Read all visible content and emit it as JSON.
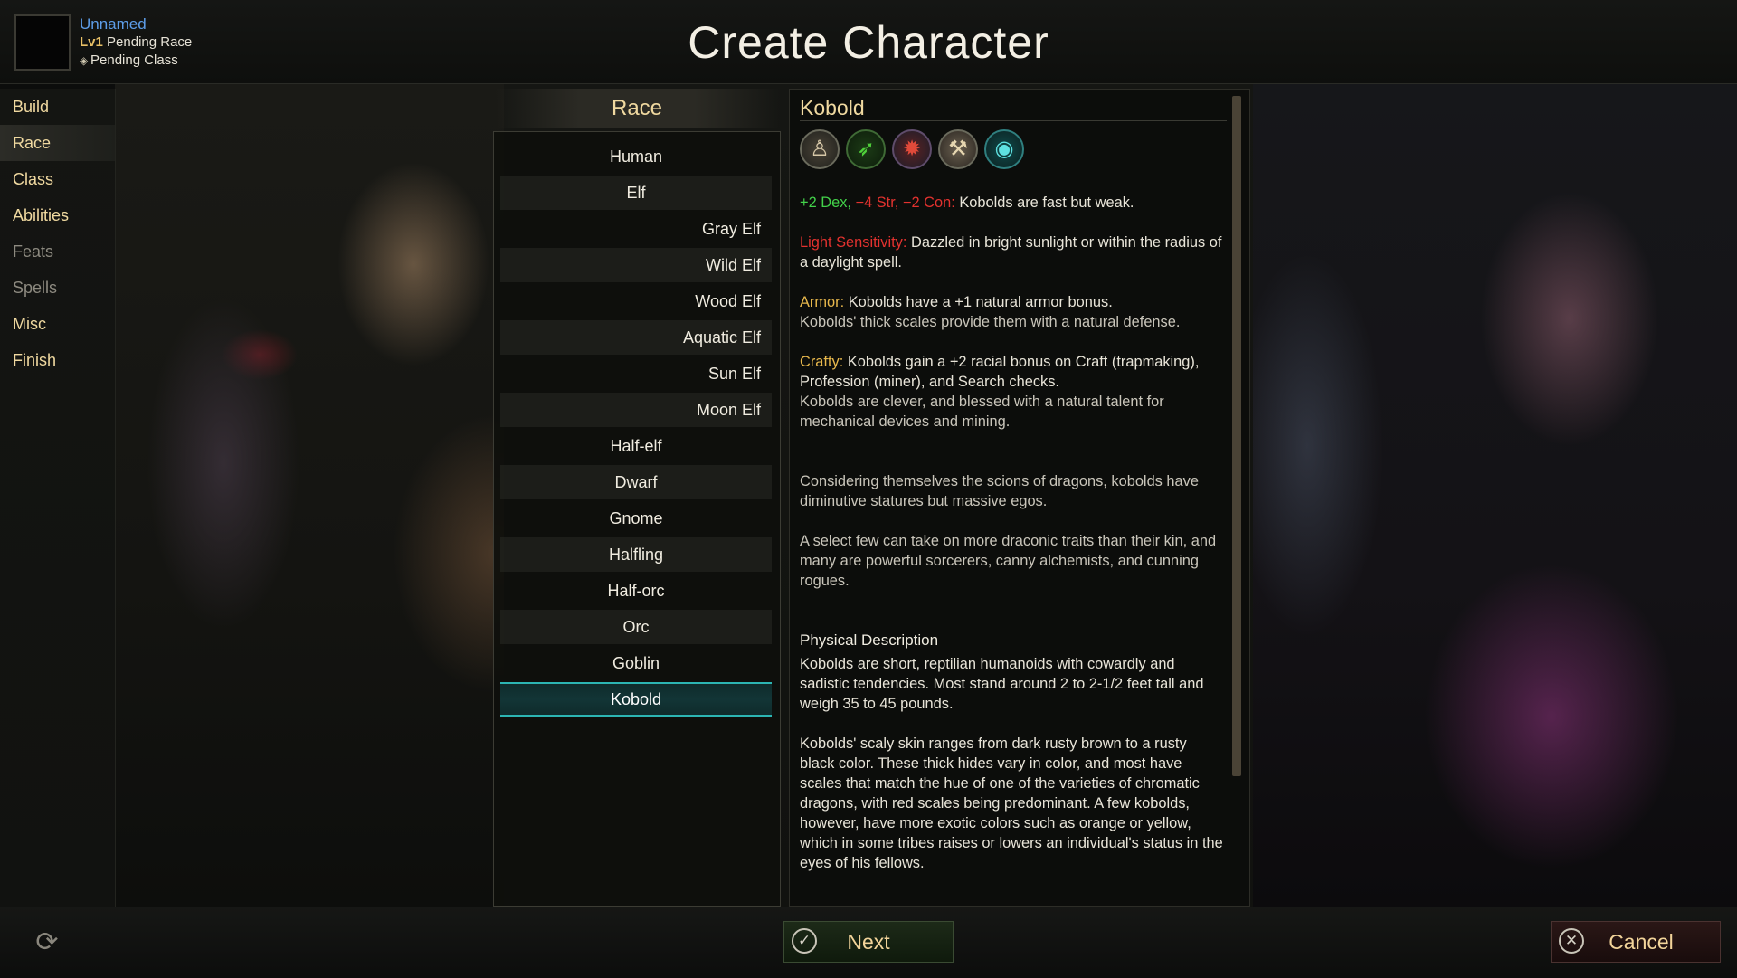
{
  "character": {
    "name": "Unnamed",
    "level_prefix": "Lv1",
    "race_status": "Pending Race",
    "class_status": "Pending Class"
  },
  "page_title": "Create Character",
  "sidebar": {
    "items": [
      {
        "label": "Build",
        "state": "enabled"
      },
      {
        "label": "Race",
        "state": "active"
      },
      {
        "label": "Class",
        "state": "enabled"
      },
      {
        "label": "Abilities",
        "state": "enabled"
      },
      {
        "label": "Feats",
        "state": "disabled"
      },
      {
        "label": "Spells",
        "state": "disabled"
      },
      {
        "label": "Misc",
        "state": "enabled"
      },
      {
        "label": "Finish",
        "state": "enabled"
      }
    ]
  },
  "race_panel": {
    "header": "Race",
    "items": [
      {
        "label": "Human",
        "align": "center"
      },
      {
        "label": "Elf",
        "align": "center"
      },
      {
        "label": "Gray Elf",
        "align": "right"
      },
      {
        "label": "Wild Elf",
        "align": "right"
      },
      {
        "label": "Wood Elf",
        "align": "right"
      },
      {
        "label": "Aquatic Elf",
        "align": "right"
      },
      {
        "label": "Sun Elf",
        "align": "right"
      },
      {
        "label": "Moon Elf",
        "align": "right"
      },
      {
        "label": "Half-elf",
        "align": "center"
      },
      {
        "label": "Dwarf",
        "align": "center"
      },
      {
        "label": "Gnome",
        "align": "center"
      },
      {
        "label": "Halfling",
        "align": "center"
      },
      {
        "label": "Half-orc",
        "align": "center"
      },
      {
        "label": "Orc",
        "align": "center"
      },
      {
        "label": "Goblin",
        "align": "center"
      },
      {
        "label": "Kobold",
        "align": "center",
        "selected": true
      }
    ]
  },
  "details": {
    "title": "Kobold",
    "trait_icons": [
      "humanoid-icon",
      "fast-runner-icon",
      "light-sensitivity-icon",
      "crafty-icon",
      "darkvision-eye-icon"
    ],
    "stats": {
      "bonus": "+2 Dex,",
      "penalty": " −4 Str, −2 Con:",
      "text": " Kobolds are fast but weak."
    },
    "light_sensitivity": {
      "label": "Light Sensitivity:",
      "text": " Dazzled in bright sunlight or within the radius of a daylight spell."
    },
    "armor": {
      "label": "Armor:",
      "text": " Kobolds have a +1 natural armor bonus.",
      "flavor": "Kobolds' thick scales provide them with a natural defense."
    },
    "crafty": {
      "label": "Crafty:",
      "text": " Kobolds gain a +2 racial bonus on Craft (trapmaking), Profession (miner), and Search checks.",
      "flavor": "Kobolds are clever, and blessed with a natural talent for mechanical devices and mining."
    },
    "lore_1": "Considering themselves the scions of dragons, kobolds have diminutive statures but massive egos.",
    "lore_2": "A select few can take on more draconic traits than their kin, and many are powerful sorcerers, canny alchemists, and cunning rogues.",
    "physical_title": "Physical Description",
    "physical_1": "Kobolds are short, reptilian humanoids with cowardly and sadistic tendencies. Most stand around 2 to 2-1/2 feet tall and weigh 35 to 45 pounds.",
    "physical_2": "Kobolds' scaly skin ranges from dark rusty brown to a rusty  black color. These thick hides vary in color, and most have scales that match the hue of one of the varieties of chromatic dragons, with red scales being predominant. A few kobolds, however, have more exotic colors such as orange or yellow, which in some tribes raises or lowers an individual's status in the eyes of his fellows."
  },
  "buttons": {
    "next": "Next",
    "cancel": "Cancel"
  },
  "colors": {
    "accent_gold": "#f0d9a0",
    "name_blue": "#5d9de8",
    "bonus_green": "#43d14a",
    "penalty_red": "#e3322f",
    "selection_teal": "#2cb5b3"
  }
}
